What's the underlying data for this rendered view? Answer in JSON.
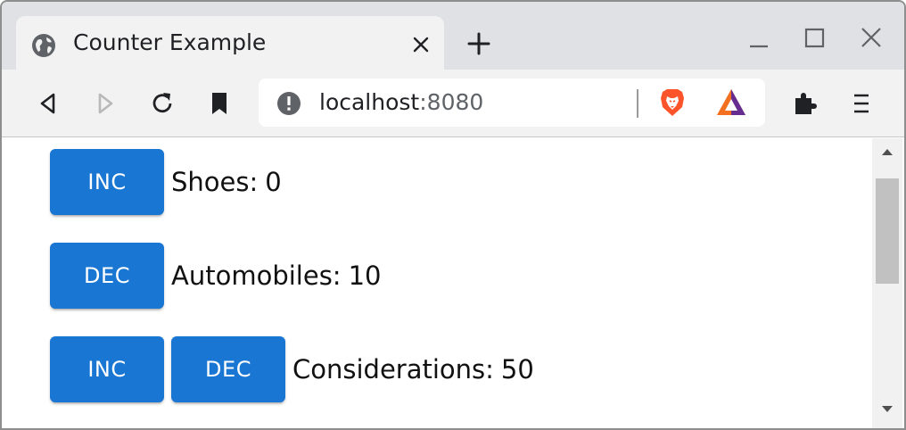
{
  "tab": {
    "title": "Counter Example"
  },
  "omnibox": {
    "host": "localhost",
    "port": ":8080"
  },
  "counters": [
    {
      "buttons": [
        "INC"
      ],
      "label": "Shoes:",
      "value": "0"
    },
    {
      "buttons": [
        "DEC"
      ],
      "label": "Automobiles:",
      "value": "10"
    },
    {
      "buttons": [
        "INC",
        "DEC"
      ],
      "label": "Considerations:",
      "value": "50"
    }
  ],
  "colors": {
    "button": "#1976d2",
    "brave_lion": "#fb542b",
    "rewards_purple": "#662d91",
    "rewards_orange": "#f37021"
  },
  "icons": {
    "favicon": "globe-icon",
    "tab_close": "close-icon",
    "new_tab": "plus-icon",
    "back": "back-icon",
    "forward": "forward-icon",
    "reload": "reload-icon",
    "bookmark": "bookmark-icon",
    "site_info": "info-icon",
    "brave_shields": "brave-lion-icon",
    "rewards": "rewards-triangle-icon",
    "extensions": "puzzle-icon",
    "menu": "hamburger-menu-icon"
  }
}
